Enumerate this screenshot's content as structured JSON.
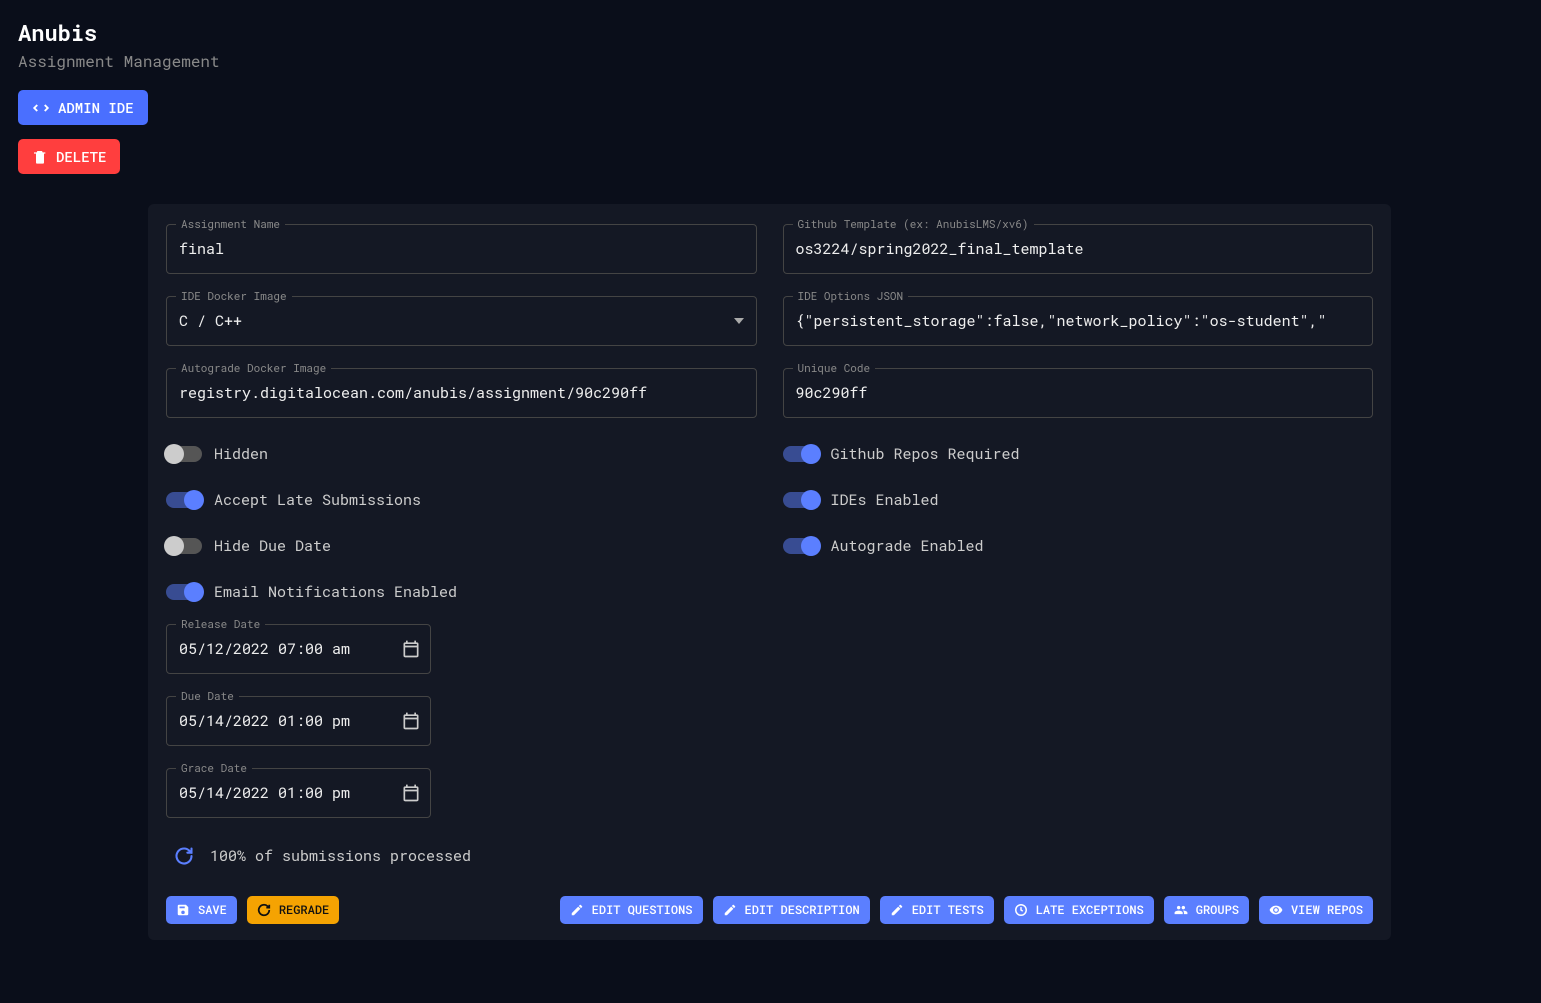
{
  "header": {
    "title": "Anubis",
    "subtitle": "Assignment Management"
  },
  "topButtons": {
    "adminIde": "ADMIN IDE",
    "delete": "DELETE"
  },
  "fields": {
    "assignmentName": {
      "label": "Assignment Name",
      "value": "final"
    },
    "githubTemplate": {
      "label": "Github Template (ex: AnubisLMS/xv6)",
      "value": "os3224/spring2022_final_template"
    },
    "ideDockerImage": {
      "label": "IDE Docker Image",
      "value": "C / C++"
    },
    "ideOptionsJson": {
      "label": "IDE Options JSON",
      "value": "{\"persistent_storage\":false,\"network_policy\":\"os-student\",\""
    },
    "autogradeDockerImage": {
      "label": "Autograde Docker Image",
      "value": "registry.digitalocean.com/anubis/assignment/90c290ff"
    },
    "uniqueCode": {
      "label": "Unique Code",
      "value": "90c290ff"
    }
  },
  "toggles": {
    "hidden": {
      "label": "Hidden",
      "on": false
    },
    "githubReposRequired": {
      "label": "Github Repos Required",
      "on": true
    },
    "acceptLate": {
      "label": "Accept Late Submissions",
      "on": true
    },
    "idesEnabled": {
      "label": "IDEs Enabled",
      "on": true
    },
    "hideDueDate": {
      "label": "Hide Due Date",
      "on": false
    },
    "autogradeEnabled": {
      "label": "Autograde Enabled",
      "on": true
    },
    "emailNotifications": {
      "label": "Email Notifications Enabled",
      "on": true
    }
  },
  "dates": {
    "release": {
      "label": "Release Date",
      "value": "05/12/2022 07:00 am"
    },
    "due": {
      "label": "Due Date",
      "value": "05/14/2022 01:00 pm"
    },
    "grace": {
      "label": "Grace Date",
      "value": "05/14/2022 01:00 pm"
    }
  },
  "status": {
    "text": "100% of submissions processed"
  },
  "bottomButtons": {
    "save": "SAVE",
    "regrade": "REGRADE",
    "editQuestions": "EDIT QUESTIONS",
    "editDescription": "EDIT DESCRIPTION",
    "editTests": "EDIT TESTS",
    "lateExceptions": "LATE EXCEPTIONS",
    "groups": "GROUPS",
    "viewRepos": "VIEW REPOS"
  }
}
